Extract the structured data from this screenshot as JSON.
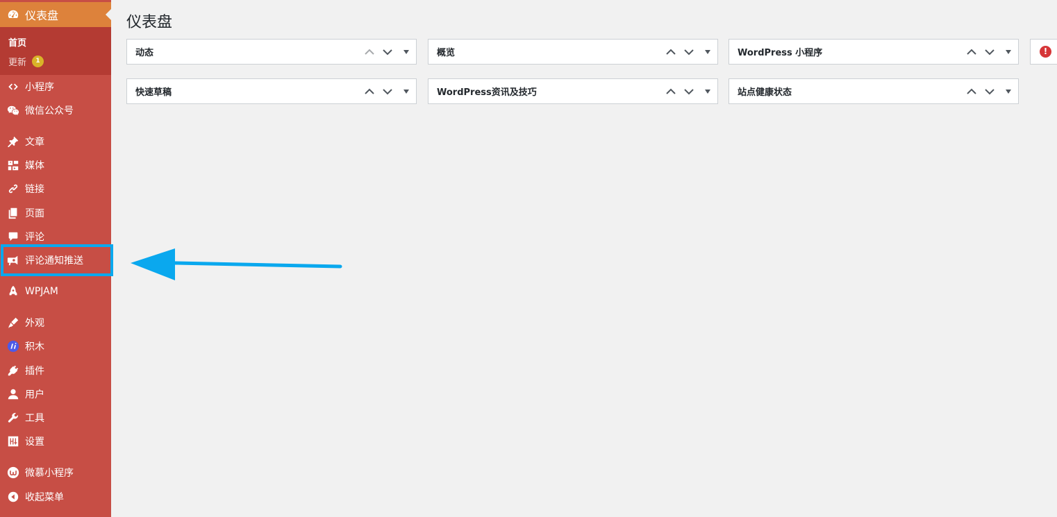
{
  "sidebar": {
    "dashboard_label": "仪表盘",
    "sub_home": "首页",
    "sub_update": "更新",
    "update_badge": "1",
    "items": [
      {
        "label": "小程序",
        "icon": "code-icon"
      },
      {
        "label": "微信公众号",
        "icon": "wechat-icon"
      },
      {
        "label": "文章",
        "icon": "pin-icon"
      },
      {
        "label": "媒体",
        "icon": "media-icon"
      },
      {
        "label": "链接",
        "icon": "link-icon"
      },
      {
        "label": "页面",
        "icon": "page-icon"
      },
      {
        "label": "评论",
        "icon": "comment-icon"
      },
      {
        "label": "评论通知推送",
        "icon": "megaphone-icon"
      },
      {
        "label": "WPJAM",
        "icon": "rocket-icon"
      },
      {
        "label": "外观",
        "icon": "brush-icon"
      },
      {
        "label": "积木",
        "icon": "jimu-icon"
      },
      {
        "label": "插件",
        "icon": "plugin-icon"
      },
      {
        "label": "用户",
        "icon": "user-icon"
      },
      {
        "label": "工具",
        "icon": "wrench-icon"
      },
      {
        "label": "设置",
        "icon": "sliders-icon"
      },
      {
        "label": "微慕小程序",
        "icon": "weimu-icon"
      },
      {
        "label": "收起菜单",
        "icon": "collapse-icon"
      }
    ]
  },
  "main": {
    "page_title": "仪表盘",
    "widgets": [
      {
        "title": "动态"
      },
      {
        "title": "概览"
      },
      {
        "title": "WordPress 小程序"
      },
      {
        "title": "快速草稿"
      },
      {
        "title": "WordPress资讯及技巧"
      },
      {
        "title": "站点健康状态"
      }
    ],
    "alert_glyph": "!"
  },
  "colors": {
    "sidebar_bg": "#c74e45",
    "active_bg": "#dd823b",
    "submenu_bg": "#b43b33",
    "annotation": "#0aa8ee"
  }
}
